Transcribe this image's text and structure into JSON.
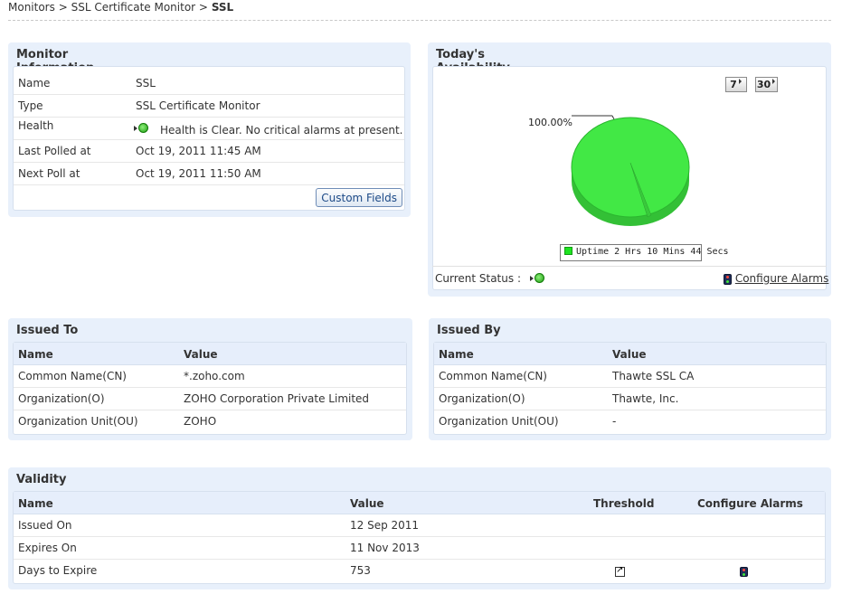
{
  "breadcrumb": {
    "items": [
      "Monitors",
      "SSL Certificate Monitor"
    ],
    "separator": ">",
    "current": "SSL"
  },
  "monitor_info": {
    "title": "Monitor Information",
    "rows": [
      {
        "label": "Name",
        "value": "SSL"
      },
      {
        "label": "Type",
        "value": "SSL Certificate Monitor"
      },
      {
        "label": "Health",
        "value": "Health is Clear. No critical alarms at present."
      },
      {
        "label": "Last Polled at",
        "value": "Oct 19, 2011 11:45 AM"
      },
      {
        "label": "Next Poll at",
        "value": "Oct 19, 2011 11:50 AM"
      }
    ],
    "custom_fields_label": "Custom Fields"
  },
  "availability": {
    "title": "Today's Availability",
    "period_buttons": [
      "7",
      "30"
    ],
    "pie_label": "100.00%",
    "legend": "Uptime 2 Hrs 10 Mins 44 Secs",
    "current_status_label": "Current Status :",
    "configure_alarms_label": "Configure Alarms",
    "uptime_color": "#1ee321"
  },
  "chart_data": {
    "type": "pie",
    "categories": [
      "Uptime 2 Hrs 10 Mins 44 Secs"
    ],
    "values": [
      100.0
    ],
    "data_labels": [
      "100.00%"
    ]
  },
  "issued_to": {
    "title": "Issued To",
    "columns": [
      "Name",
      "Value"
    ],
    "rows": [
      [
        "Common Name(CN)",
        "*.zoho.com"
      ],
      [
        "Organization(O)",
        "ZOHO Corporation Private Limited"
      ],
      [
        "Organization Unit(OU)",
        "ZOHO"
      ]
    ]
  },
  "issued_by": {
    "title": "Issued By",
    "columns": [
      "Name",
      "Value"
    ],
    "rows": [
      [
        "Common Name(CN)",
        "Thawte SSL CA"
      ],
      [
        "Organization(O)",
        "Thawte, Inc."
      ],
      [
        "Organization Unit(OU)",
        "-"
      ]
    ]
  },
  "validity": {
    "title": "Validity",
    "columns": [
      "Name",
      "Value",
      "Threshold",
      "Configure Alarms"
    ],
    "rows": [
      [
        "Issued On",
        "12 Sep 2011"
      ],
      [
        "Expires On",
        "11 Nov 2013"
      ],
      [
        "Days to Expire",
        "753"
      ]
    ]
  },
  "colors": {
    "panel_bg": "#e8f0fb",
    "header_bg": "#e6eefb",
    "button_text": "#1d4a87"
  }
}
